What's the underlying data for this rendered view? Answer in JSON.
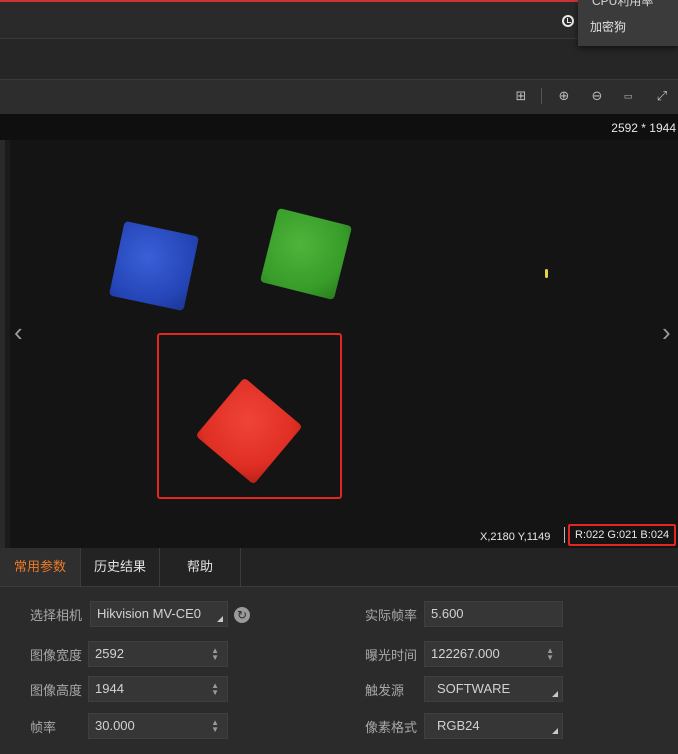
{
  "topbar": {
    "dropdown_cut_item": "CPU利用率",
    "dropdown_item": "加密狗"
  },
  "viewer": {
    "resolution": "2592 * 1944",
    "coords": "X,2180  Y,1149",
    "rgb": "R:022  G:021  B:024",
    "nav_prev": "‹",
    "nav_next": "›"
  },
  "tabs": [
    {
      "label": "常用参数"
    },
    {
      "label": "历史结果"
    },
    {
      "label": "帮助"
    }
  ],
  "params": {
    "camera": {
      "label": "选择相机",
      "value": "Hikvision MV-CE0"
    },
    "fps_actual": {
      "label": "实际帧率",
      "value": "5.600"
    },
    "width": {
      "label": "图像宽度",
      "value": "2592"
    },
    "exposure": {
      "label": "曝光时间",
      "value": "122267.000"
    },
    "height": {
      "label": "图像高度",
      "value": "1944"
    },
    "trigger": {
      "label": "触发源",
      "value": "SOFTWARE"
    },
    "fps": {
      "label": "帧率",
      "value": "30.000"
    },
    "pixel_format": {
      "label": "像素格式",
      "value": "RGB24"
    }
  },
  "colors": {
    "accent": "#f07a28",
    "roi": "#e3261f"
  }
}
